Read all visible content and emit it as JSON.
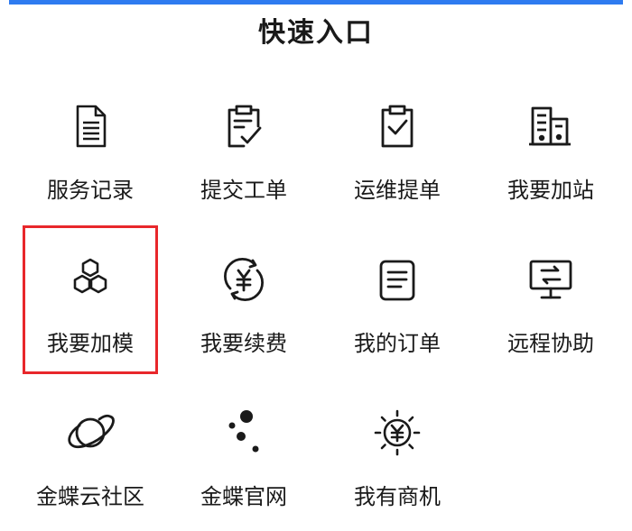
{
  "header": {
    "title": "快速入口"
  },
  "tiles": [
    {
      "label": "服务记录",
      "icon": "document-icon"
    },
    {
      "label": "提交工单",
      "icon": "clipboard-edit-icon"
    },
    {
      "label": "运维提单",
      "icon": "clipboard-check-icon"
    },
    {
      "label": "我要加站",
      "icon": "buildings-icon"
    },
    {
      "label": "我要加模",
      "icon": "hexagons-icon"
    },
    {
      "label": "我要续费",
      "icon": "yen-refresh-icon"
    },
    {
      "label": "我的订单",
      "icon": "order-list-icon"
    },
    {
      "label": "远程协助",
      "icon": "remote-monitor-icon"
    },
    {
      "label": "金蝶云社区",
      "icon": "planet-icon"
    },
    {
      "label": "金蝶官网",
      "icon": "dots-icon"
    },
    {
      "label": "我有商机",
      "icon": "yen-sun-icon"
    }
  ],
  "colors": {
    "accent": "#2e7bf0",
    "highlight": "#e8272b",
    "icon": "#1a1a1a"
  }
}
